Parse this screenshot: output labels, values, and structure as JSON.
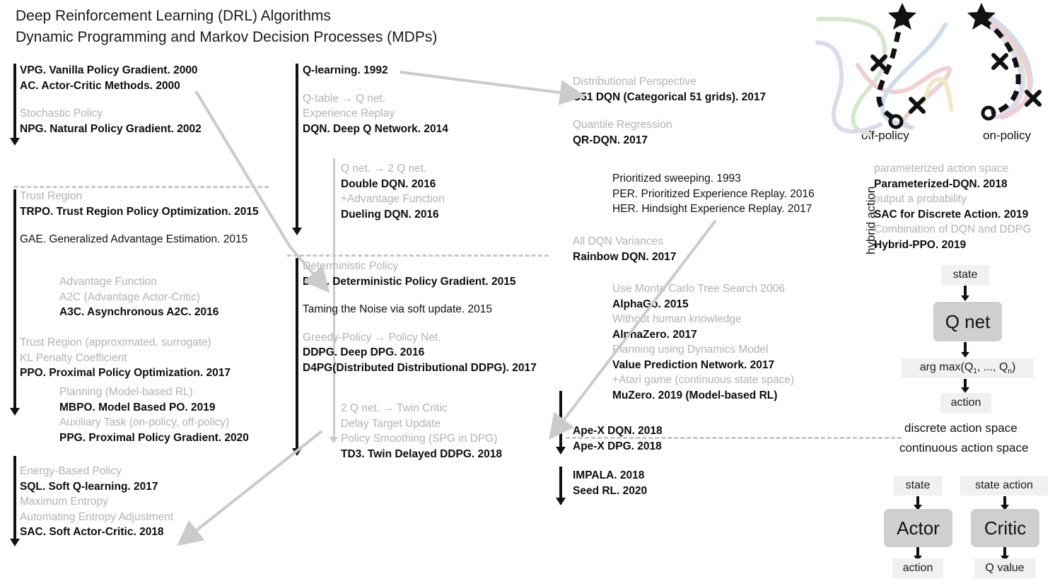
{
  "title": {
    "line1": "Deep Reinforcement Learning (DRL) Algorithms",
    "line2": "Dynamic Programming and Markov Decision Processes (MDPs)"
  },
  "col1": {
    "group1": [
      {
        "t": "VPG. Vanilla Policy Gradient. 2000",
        "s": "b"
      },
      {
        "t": "AC. Actor-Critic Methods. 2000",
        "s": "b"
      },
      {
        "t": "",
        "s": "sp"
      },
      {
        "t": "Stochastic Policy",
        "s": "g"
      },
      {
        "t": "NPG. Natural Policy Gradient. 2002",
        "s": "b"
      }
    ],
    "group2": [
      {
        "t": "Trust Region",
        "s": "g"
      },
      {
        "t": "TRPO. Trust Region Policy Optimization. 2015",
        "s": "b"
      },
      {
        "t": "",
        "s": "sp"
      },
      {
        "t": "GAE. Generalized Advantage Estimation. 2015",
        "s": "n"
      }
    ],
    "group2b": [
      {
        "t": "Advantage Function",
        "s": "g"
      },
      {
        "t": "A2C (Advantage Actor-Critic)",
        "s": "g"
      },
      {
        "t": "A3C. Asynchronous A2C. 2016",
        "s": "b"
      }
    ],
    "group2c": [
      {
        "t": "Trust Region (approximated, surrogate)",
        "s": "g"
      },
      {
        "t": "KL Penalty Coefficient",
        "s": "g"
      },
      {
        "t": "PPO. Proximal Policy Optimization. 2017",
        "s": "b"
      }
    ],
    "group2d": [
      {
        "t": "Planning (Model-based RL)",
        "s": "g"
      },
      {
        "t": "MBPO. Model Based PO. 2019",
        "s": "b"
      },
      {
        "t": "Auxiliary Task (on-policy, off-policy)",
        "s": "g"
      },
      {
        "t": "PPG. Proximal Policy Gradient. 2020",
        "s": "b"
      }
    ],
    "group3": [
      {
        "t": "Energy-Based Policy",
        "s": "g"
      },
      {
        "t": "SQL. Soft Q-learning. 2017",
        "s": "b"
      },
      {
        "t": "Maximum Entropy",
        "s": "g"
      },
      {
        "t": "Automating Entropy Adjustment",
        "s": "g"
      },
      {
        "t": "SAC. Soft Actor-Critic. 2018",
        "s": "b"
      }
    ]
  },
  "col2": {
    "group1": [
      {
        "t": "Q-learning. 1992",
        "s": "b"
      },
      {
        "t": "",
        "s": "sp"
      },
      {
        "t": "Q-table → Q net.",
        "s": "g"
      },
      {
        "t": "Experience Replay",
        "s": "g"
      },
      {
        "t": "DQN. Deep Q Network. 2014",
        "s": "b"
      }
    ],
    "group1b": [
      {
        "t": "Q net. → 2 Q net.",
        "s": "g"
      },
      {
        "t": "Double DQN. 2016",
        "s": "b"
      },
      {
        "t": "+Advantage Function",
        "s": "g"
      },
      {
        "t": "Dueling DQN. 2016",
        "s": "b"
      }
    ],
    "group2": [
      {
        "t": "Deterministic Policy",
        "s": "g"
      },
      {
        "t": "DPG. Deterministic Policy Gradient. 2015",
        "s": "b"
      },
      {
        "t": "",
        "s": "sp"
      },
      {
        "t": "Taming the Noise via soft update. 2015",
        "s": "n"
      },
      {
        "t": "",
        "s": "sp"
      },
      {
        "t": "Greedy-Policy → Policy Net.",
        "s": "g"
      },
      {
        "t": "DDPG. Deep DPG. 2016",
        "s": "b"
      },
      {
        "t": "D4PG(Distributed Distributional DDPG). 2017",
        "s": "b"
      }
    ],
    "group2b": [
      {
        "t": "2 Q net. → Twin Critic",
        "s": "g"
      },
      {
        "t": "Delay Target Update",
        "s": "g"
      },
      {
        "t": "Policy Smoothing (SPG in DPG)",
        "s": "g"
      },
      {
        "t": "TD3. Twin Delayed DDPG. 2018",
        "s": "b"
      }
    ]
  },
  "col3": {
    "group1": [
      {
        "t": "Distributional Perspective",
        "s": "g"
      },
      {
        "t": "C51 DQN (Categorical 51 grids). 2017",
        "s": "b"
      },
      {
        "t": "",
        "s": "sp"
      },
      {
        "t": "Quantile Regression",
        "s": "g"
      },
      {
        "t": "QR-DQN. 2017",
        "s": "b"
      }
    ],
    "group1b": [
      {
        "t": "Prioritized sweeping. 1993",
        "s": "n"
      },
      {
        "t": "PER. Prioritized Experience Replay. 2016",
        "s": "n"
      },
      {
        "t": "HER. Hindsight Experience Replay. 2017",
        "s": "n"
      }
    ],
    "group2": [
      {
        "t": "All DQN Variances",
        "s": "g"
      },
      {
        "t": "Rainbow DQN. 2017",
        "s": "b"
      }
    ],
    "group2b": [
      {
        "t": "Use Monte Carlo Tree Search 2006",
        "s": "g"
      },
      {
        "t": "AlphaGo. 2015",
        "s": "b"
      },
      {
        "t": "Without human knowledge",
        "s": "g"
      },
      {
        "t": "AlphaZero. 2017",
        "s": "b"
      },
      {
        "t": "Planning using Dynamics Model",
        "s": "g"
      },
      {
        "t": "Value Prediction Network. 2017",
        "s": "b"
      },
      {
        "t": "+Atari game (continuous state space)",
        "s": "g"
      },
      {
        "t": "MuZero. 2019 (Model-based RL)",
        "s": "b"
      }
    ],
    "group3": [
      {
        "t": "Ape-X DQN. 2018",
        "s": "b"
      },
      {
        "t": "Ape-X DPG. 2018",
        "s": "b"
      }
    ],
    "group4": [
      {
        "t": "IMPALA. 2018",
        "s": "b"
      },
      {
        "t": "Seed RL. 2020",
        "s": "b"
      }
    ]
  },
  "col4": {
    "rotated_label": "hybrid action",
    "items": [
      {
        "t": "parameterized action space",
        "s": "g"
      },
      {
        "t": "Parameterized-DQN. 2018",
        "s": "b"
      },
      {
        "t": "output a probability",
        "s": "g"
      },
      {
        "t": "SAC for Discrete Action. 2019",
        "s": "b"
      },
      {
        "t": "Combination of DQN and DDPG",
        "s": "g"
      },
      {
        "t": "Hybrid-PPO. 2019",
        "s": "b"
      }
    ],
    "policy_fig": {
      "off_policy_label": "off-policy",
      "on_policy_label": "on-policy"
    },
    "qnet_diagram": {
      "state": "state",
      "net": "Q net",
      "argmax_prefix": "arg max(Q",
      "argmax_sub1": "1",
      "argmax_mid": ", ..., Q",
      "argmax_sub2": "n",
      "argmax_suffix": ")",
      "action": "action"
    },
    "space_labels": {
      "discrete": "discrete action space",
      "continuous": "continuous action space"
    },
    "ac_diagram": {
      "actor_state": "state",
      "actor": "Actor",
      "actor_out": "action",
      "critic_state": "state action",
      "critic": "Critic",
      "critic_out": "Q value"
    }
  },
  "colors": {
    "gray_text": "#b3b3b3",
    "black_text": "#111111",
    "arrow_black": "#111111",
    "arrow_gray": "#cbcbcb",
    "box_light": "#f0f0f0",
    "box_dark": "#cfcfcf"
  }
}
